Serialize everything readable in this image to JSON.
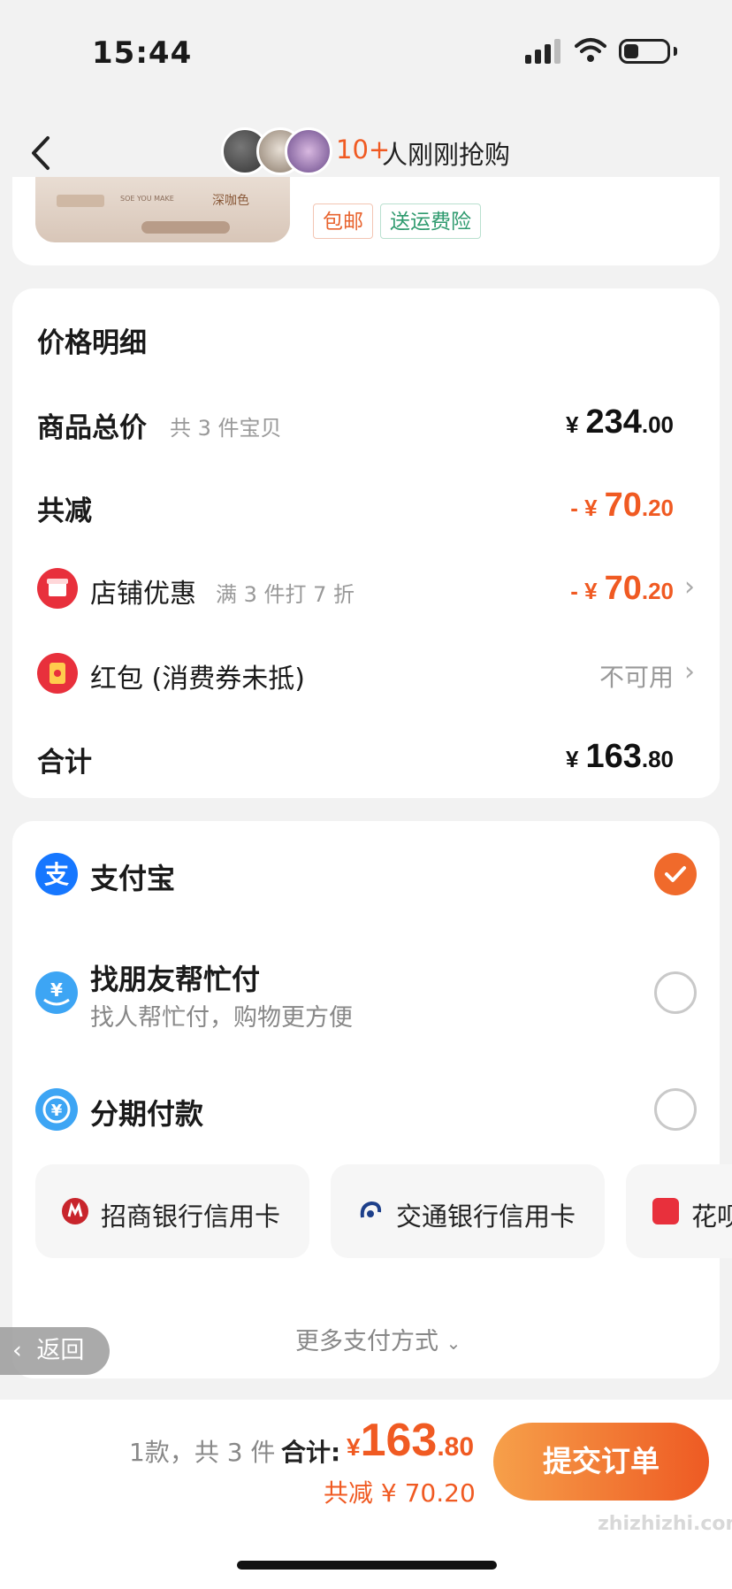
{
  "status_bar": {
    "time": "15:44"
  },
  "nav": {
    "count": "10+",
    "text": "人刚刚抢购"
  },
  "product": {
    "image_label_left": "SOE YOU MAKE",
    "image_label_color": "深咖色",
    "tags": [
      "包邮",
      "送运费险"
    ]
  },
  "price_detail": {
    "title": "价格明细",
    "rows": [
      {
        "label": "商品总价",
        "note": "共 3 件宝贝",
        "currency": "¥",
        "int": "234",
        "dec": ".00"
      },
      {
        "label": "共减",
        "currency": "- ¥",
        "int": "70",
        "dec": ".20"
      },
      {
        "label": "店铺优惠",
        "note": "满 3 件打 7 折",
        "currency": "- ¥",
        "int": "70",
        "dec": ".20"
      },
      {
        "label": "红包 (消费券未抵)",
        "value": "不可用"
      },
      {
        "label": "合计",
        "currency": "¥",
        "int": "163",
        "dec": ".80"
      }
    ]
  },
  "payment": {
    "options": [
      {
        "title": "支付宝",
        "selected": true
      },
      {
        "title": "找朋友帮忙付",
        "subtitle": "找人帮忙付，购物更方便",
        "selected": false
      },
      {
        "title": "分期付款",
        "selected": false
      }
    ],
    "installment_cards": [
      "招商银行信用卡",
      "交通银行信用卡",
      "花呗"
    ],
    "more": "更多支付方式"
  },
  "floating_back": "返回",
  "footer": {
    "count": "1款，共 3 件",
    "total_label": "合计:",
    "currency": "¥",
    "total_int": "163",
    "total_dec": ".80",
    "saved": "共减 ¥ 70.20",
    "submit": "提交订单"
  },
  "watermark": "zhizhizhi.com",
  "colors": {
    "accent": "#f05a22",
    "green": "#2e9a6e"
  }
}
